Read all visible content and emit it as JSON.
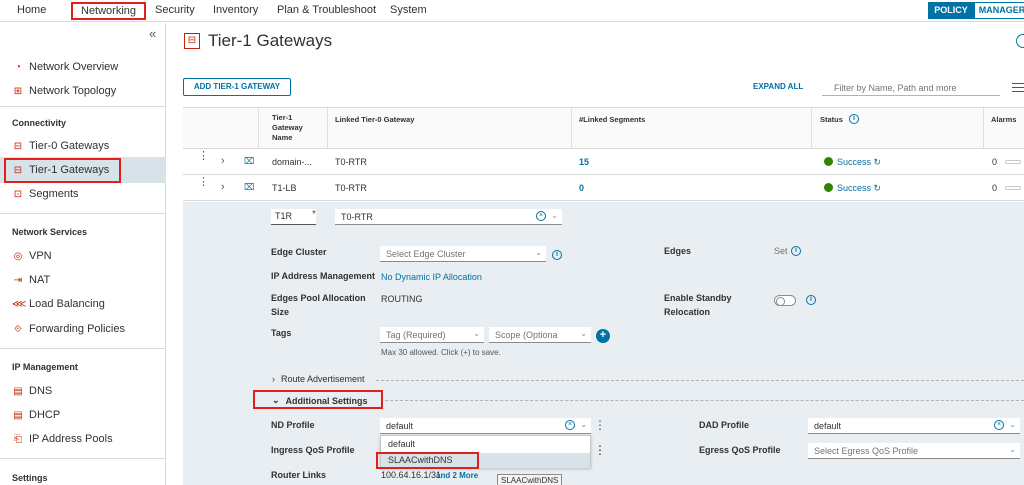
{
  "topnav": {
    "tabs": [
      "Home",
      "Networking",
      "Security",
      "Inventory",
      "Plan & Troubleshoot",
      "System"
    ],
    "active": "Networking",
    "policy": "POLICY",
    "manager": "MANAGER"
  },
  "sidebar": {
    "collapse_glyph": "«",
    "top_items": [
      {
        "label": "Network Overview",
        "icon": "overview-icon"
      },
      {
        "label": "Network Topology",
        "icon": "topology-icon"
      }
    ],
    "connectivity": {
      "heading": "Connectivity",
      "items": [
        {
          "label": "Tier-0 Gateways",
          "icon": "gateway-icon"
        },
        {
          "label": "Tier-1 Gateways",
          "icon": "gateway-icon",
          "selected": true
        },
        {
          "label": "Segments",
          "icon": "segments-icon"
        }
      ]
    },
    "network_services": {
      "heading": "Network Services",
      "items": [
        {
          "label": "VPN",
          "icon": "vpn-icon"
        },
        {
          "label": "NAT",
          "icon": "nat-icon"
        },
        {
          "label": "Load Balancing",
          "icon": "load-balancing-icon"
        },
        {
          "label": "Forwarding Policies",
          "icon": "forwarding-icon"
        }
      ]
    },
    "ip_management": {
      "heading": "IP Management",
      "items": [
        {
          "label": "DNS",
          "icon": "dns-icon"
        },
        {
          "label": "DHCP",
          "icon": "dhcp-icon"
        },
        {
          "label": "IP Address Pools",
          "icon": "ip-pool-icon"
        }
      ]
    },
    "settings_heading": "Settings"
  },
  "main": {
    "title": "Tier-1 Gateways",
    "add_button": "ADD TIER-1 GATEWAY",
    "expand_all": "EXPAND ALL",
    "filter_placeholder": "Filter by Name, Path and more"
  },
  "table": {
    "headers": {
      "name": "Tier-1 Gateway Name",
      "linked_t0": "Linked Tier-0 Gateway",
      "linked_segments": "#Linked Segments",
      "status": "Status",
      "alarms": "Alarms"
    },
    "rows": [
      {
        "name": "domain-...",
        "linked_t0": "T0-RTR",
        "segments": "15",
        "status": "Success",
        "alarms": "0"
      },
      {
        "name": "T1-LB",
        "linked_t0": "T0-RTR",
        "segments": "0",
        "status": "Success",
        "alarms": "0"
      }
    ]
  },
  "expanded": {
    "name_value": "T1R",
    "t0_select": "T0-RTR",
    "edge_cluster_label": "Edge Cluster",
    "edge_cluster_placeholder": "Select Edge Cluster",
    "edges_label": "Edges",
    "edges_value": "Set",
    "ip_mgmt_label": "IP Address Management",
    "ip_mgmt_value": "No Dynamic IP Allocation",
    "edges_pool_label_1": "Edges Pool Allocation",
    "edges_pool_label_2": "Size",
    "edges_pool_value": "ROUTING",
    "standby_label_1": "Enable Standby",
    "standby_label_2": "Relocation",
    "tags_label": "Tags",
    "tag_placeholder": "Tag (Required)",
    "scope_placeholder": "Scope (Optiona",
    "tags_hint": "Max 30 allowed. Click (+) to save.",
    "route_adv": "Route Advertisement",
    "additional_settings": "Additional Settings",
    "nd_profile_label": "ND Profile",
    "nd_profile_value": "default",
    "dad_profile_label": "DAD Profile",
    "dad_profile_value": "default",
    "ingress_label": "Ingress QoS Profile",
    "egress_label": "Egress QoS Profile",
    "egress_placeholder": "Select Egress QoS Profile",
    "router_links_label": "Router Links",
    "router_links_value": "100.64.16.1/31",
    "router_links_more": "and 2 More",
    "dropdown_options": [
      "default",
      "SLAACwithDNS"
    ],
    "tooltip": "SLAACwithDNS"
  },
  "colors": {
    "accent": "#0072a3",
    "highlight_box": "#e0201a",
    "success": "#2f8400",
    "expanded_bg": "#e8eef1"
  }
}
